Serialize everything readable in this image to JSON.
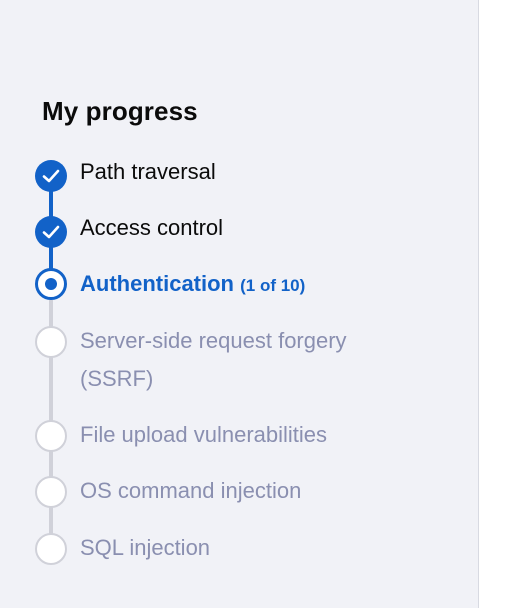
{
  "heading": "My progress",
  "steps": [
    {
      "label": "Path traversal",
      "state": "done"
    },
    {
      "label": "Access control",
      "state": "done"
    },
    {
      "label": "Authentication",
      "count": "(1 of 10)",
      "state": "current"
    },
    {
      "label": "Server-side request forgery (SSRF)",
      "state": "todo"
    },
    {
      "label": "File upload vulnerabilities",
      "state": "todo"
    },
    {
      "label": "OS command injection",
      "state": "todo"
    },
    {
      "label": "SQL injection",
      "state": "todo"
    }
  ],
  "colors": {
    "accent": "#1262c8",
    "pending": "#8a8fb0",
    "track": "#d0d1d9",
    "panel": "#f1f2f7"
  },
  "icons": {
    "done": "check-icon",
    "current": "current-dot-icon",
    "todo": "empty-circle-icon"
  }
}
